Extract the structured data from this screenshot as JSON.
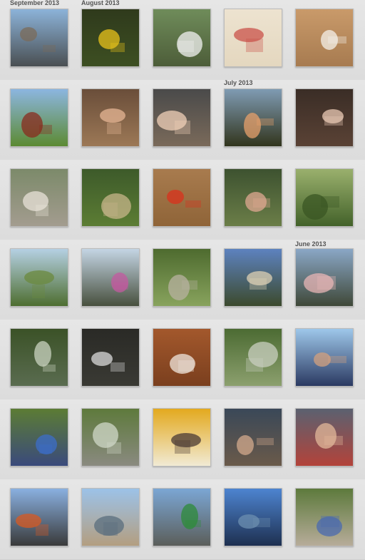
{
  "labels": {
    "sep2013": "September 2013",
    "aug2013": "August 2013",
    "jul2013": "July 2013",
    "jun2013": "June 2013"
  },
  "photos": [
    {
      "name": "photo-river-walk",
      "top": "#8cb3d9",
      "bottom": "#4a4f52",
      "accent": "#7b6b5a"
    },
    {
      "name": "photo-sunflower",
      "top": "#2f3a1c",
      "bottom": "#3d4f22",
      "accent": "#e8c21b"
    },
    {
      "name": "photo-garden-sign",
      "top": "#6f8c5a",
      "bottom": "#4d5d39",
      "accent": "#f2f2f2"
    },
    {
      "name": "photo-collage-portraits",
      "top": "#ede3d0",
      "bottom": "#e4d7bf",
      "accent": "#c9524a"
    },
    {
      "name": "photo-white-dog-deck",
      "top": "#c99a6a",
      "bottom": "#a77b50",
      "accent": "#f4f0ea"
    },
    {
      "name": "photo-shoes-on-grass",
      "top": "#8cb6e0",
      "bottom": "#5c8a32",
      "accent": "#8a2b1e"
    },
    {
      "name": "photo-three-friends",
      "top": "#6a4e3a",
      "bottom": "#9c7856",
      "accent": "#e6b694"
    },
    {
      "name": "photo-mother-child",
      "top": "#4a4a4a",
      "bottom": "#7a6a5a",
      "accent": "#f0d0b8"
    },
    {
      "name": "photo-sunset-field",
      "top": "#7f9bb3",
      "bottom": "#32351d",
      "accent": "#e7a06b"
    },
    {
      "name": "photo-latte-cup",
      "top": "#3a2d26",
      "bottom": "#5a4235",
      "accent": "#e9c9b4"
    },
    {
      "name": "photo-dog-on-road",
      "top": "#7c8a6a",
      "bottom": "#a39c8f",
      "accent": "#e8e2d8"
    },
    {
      "name": "photo-tomato-garden",
      "top": "#3d5a2a",
      "bottom": "#5c7d34",
      "accent": "#c7b58a"
    },
    {
      "name": "photo-harvest-tomatoes",
      "top": "#a87b4e",
      "bottom": "#8f6438",
      "accent": "#d9321c"
    },
    {
      "name": "photo-hand-bug",
      "top": "#3d5230",
      "bottom": "#6b7e48",
      "accent": "#dfa891"
    },
    {
      "name": "photo-green-fence",
      "top": "#9ab06d",
      "bottom": "#43622a",
      "accent": "#3a5623"
    },
    {
      "name": "photo-tree-park",
      "top": "#b5d0e3",
      "bottom": "#4e6e30",
      "accent": "#6b8a3e"
    },
    {
      "name": "photo-flower-street",
      "top": "#c4d5e4",
      "bottom": "#48503e",
      "accent": "#c45aa0"
    },
    {
      "name": "photo-creek-woods",
      "top": "#4e6b2f",
      "bottom": "#88a35d",
      "accent": "#b8b2a0"
    },
    {
      "name": "photo-library-building",
      "top": "#5d82bf",
      "bottom": "#3c4a2d",
      "accent": "#ddd0b4"
    },
    {
      "name": "photo-pink-sky",
      "top": "#8aa7c6",
      "bottom": "#3f4838",
      "accent": "#e8b6b6"
    },
    {
      "name": "photo-stream",
      "top": "#3b5227",
      "bottom": "#5a6c50",
      "accent": "#cad3c0"
    },
    {
      "name": "photo-chalkboard",
      "top": "#2a2a26",
      "bottom": "#3a3a34",
      "accent": "#d9d9d9"
    },
    {
      "name": "photo-dog-sleeping",
      "top": "#a3582c",
      "bottom": "#7a3f1e",
      "accent": "#efe6dc"
    },
    {
      "name": "photo-forest-path",
      "top": "#4c6b33",
      "bottom": "#8ca06e",
      "accent": "#c9cfc0"
    },
    {
      "name": "photo-man-sunglasses",
      "top": "#9ec7ea",
      "bottom": "#2b3a62",
      "accent": "#d3a07e"
    },
    {
      "name": "photo-tree-sign",
      "top": "#5c7c34",
      "bottom": "#3a4a7c",
      "accent": "#3c6ec8"
    },
    {
      "name": "photo-shaded-path",
      "top": "#5e7a3c",
      "bottom": "#8a8a80",
      "accent": "#d0d8c8"
    },
    {
      "name": "photo-yellow-room",
      "top": "#e3a91e",
      "bottom": "#f1ead4",
      "accent": "#4a3a34"
    },
    {
      "name": "photo-family-cafe",
      "top": "#3a4858",
      "bottom": "#6a5a4a",
      "accent": "#d3a98c"
    },
    {
      "name": "photo-kids-couch",
      "top": "#5b6170",
      "bottom": "#b3433a",
      "accent": "#e2b89a"
    },
    {
      "name": "photo-city-terrace",
      "top": "#8ab0e0",
      "bottom": "#3a3a3a",
      "accent": "#d85a22"
    },
    {
      "name": "photo-boardwalk",
      "top": "#9cc2e8",
      "bottom": "#b39e80",
      "accent": "#5a6e7e"
    },
    {
      "name": "photo-downtown-sign",
      "top": "#7ba6d4",
      "bottom": "#5b5e5a",
      "accent": "#2e8b3a"
    },
    {
      "name": "photo-skyscraper",
      "top": "#4d84d0",
      "bottom": "#1e3050",
      "accent": "#6c8fb0"
    },
    {
      "name": "photo-crowd-festival",
      "top": "#5d7a3c",
      "bottom": "#b7ac9a",
      "accent": "#4a6ab0"
    }
  ]
}
